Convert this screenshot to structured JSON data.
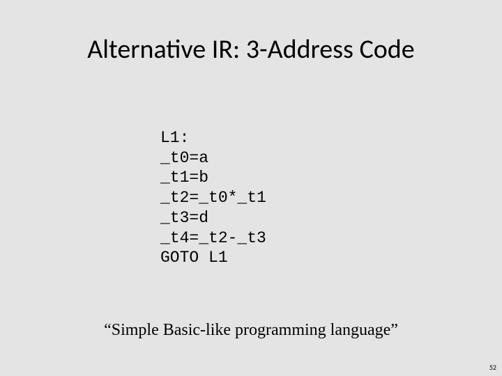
{
  "title": "Alternative IR: 3-Address Code",
  "code": {
    "lines": [
      "L1:",
      "_t0=a",
      "_t1=b",
      "_t2=_t0*_t1",
      "_t3=d",
      "_t4=_t2-_t3",
      "GOTO L1"
    ]
  },
  "caption": "“Simple Basic-like programming language”",
  "page": "52"
}
